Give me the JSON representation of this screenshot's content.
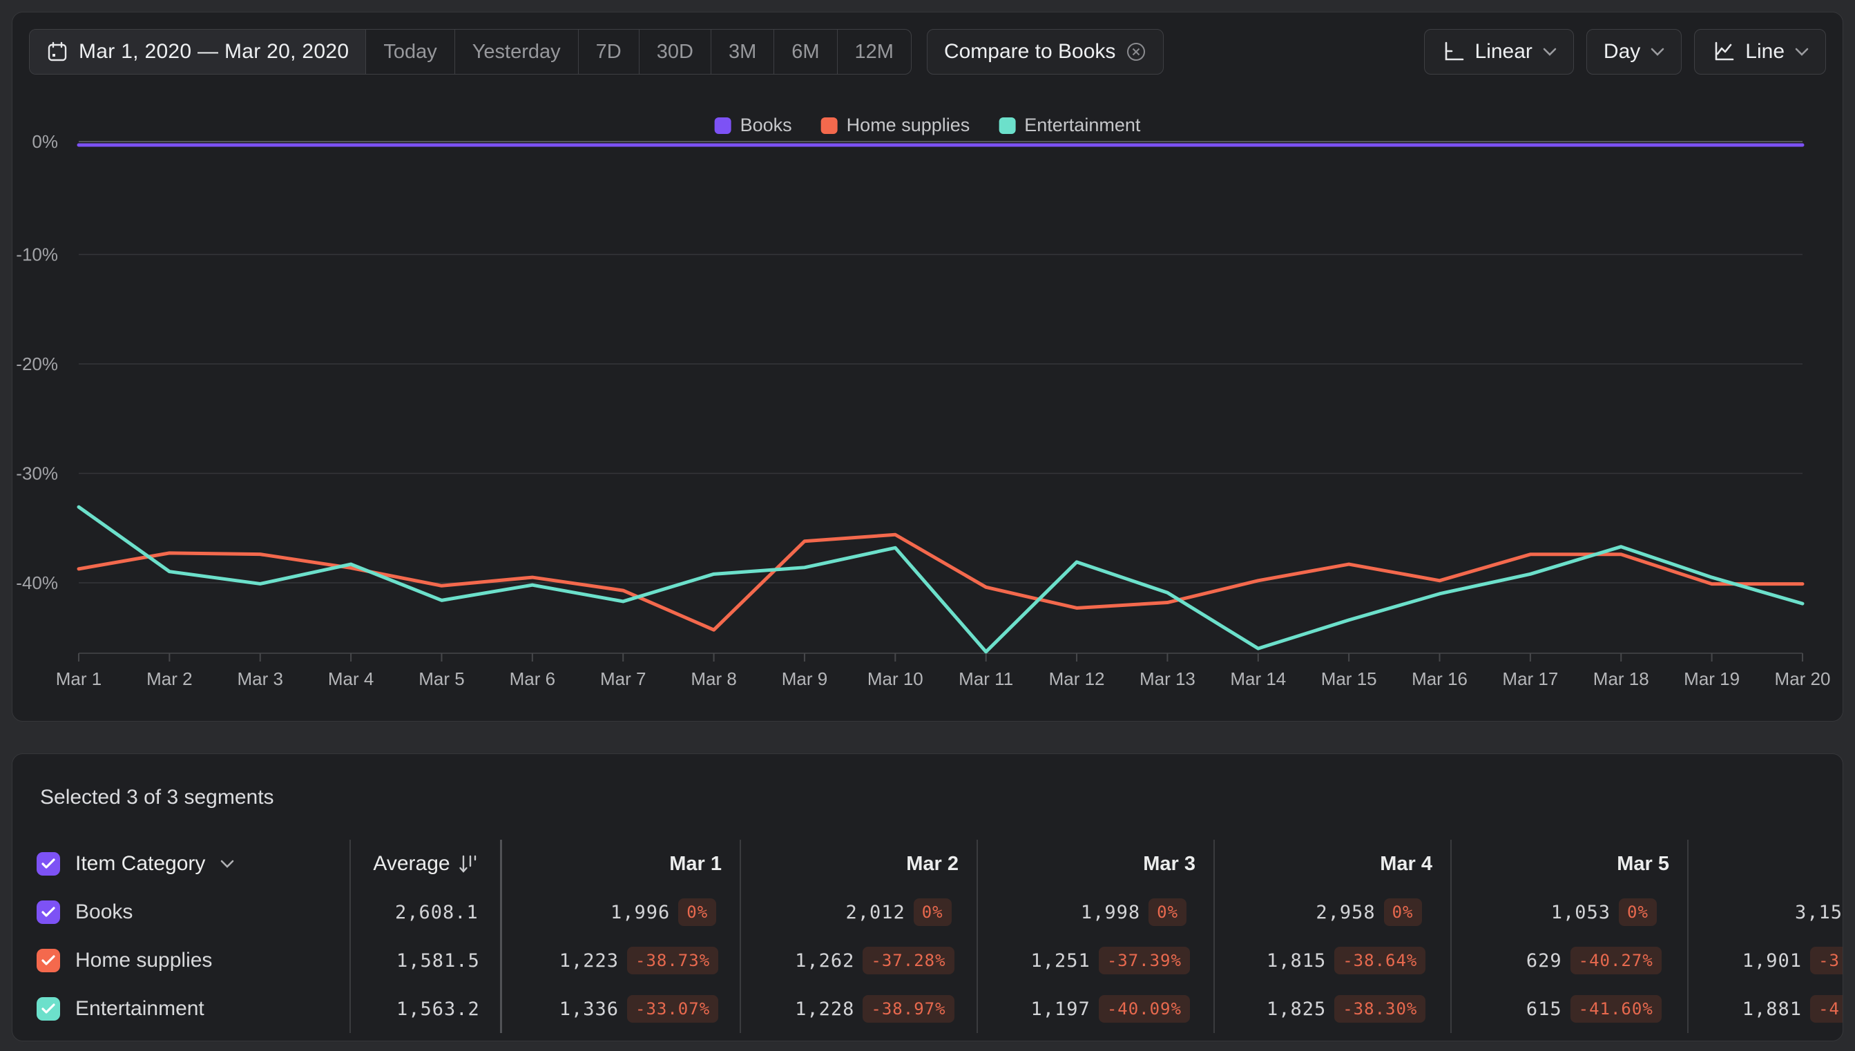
{
  "toolbar": {
    "date_range": "Mar 1, 2020 — Mar 20, 2020",
    "quick_ranges": [
      "Today",
      "Yesterday",
      "7D",
      "30D",
      "3M",
      "6M",
      "12M"
    ],
    "compare_label": "Compare to Books",
    "scale_label": "Linear",
    "granularity_label": "Day",
    "chart_type_label": "Line"
  },
  "legend": [
    {
      "label": "Books",
      "color": "#7d52f5"
    },
    {
      "label": "Home supplies",
      "color": "#f4694d"
    },
    {
      "label": "Entertainment",
      "color": "#6ce0cb"
    }
  ],
  "chart_data": {
    "type": "line",
    "title": "",
    "grid": "horizontal",
    "legend_position": "top-center",
    "ylim": [
      -46.5,
      0
    ],
    "y_ticks": [
      {
        "label": "0%",
        "value": 0
      },
      {
        "label": "-10%",
        "value": -10
      },
      {
        "label": "-20%",
        "value": -20
      },
      {
        "label": "-30%",
        "value": -30
      },
      {
        "label": "-40%",
        "value": -40
      }
    ],
    "x": [
      "Mar 1",
      "Mar 2",
      "Mar 3",
      "Mar 4",
      "Mar 5",
      "Mar 6",
      "Mar 7",
      "Mar 8",
      "Mar 9",
      "Mar 10",
      "Mar 11",
      "Mar 12",
      "Mar 13",
      "Mar 14",
      "Mar 15",
      "Mar 16",
      "Mar 17",
      "Mar 18",
      "Mar 19",
      "Mar 20"
    ],
    "series": [
      {
        "name": "Books",
        "color": "#7d52f5",
        "values": [
          0,
          0,
          0,
          0,
          0,
          0,
          0,
          0,
          0,
          0,
          0,
          0,
          0,
          0,
          0,
          0,
          0,
          0,
          0,
          0
        ]
      },
      {
        "name": "Home supplies",
        "color": "#f4694d",
        "values": [
          -38.73,
          -37.28,
          -37.39,
          -38.64,
          -40.27,
          -39.5,
          -40.7,
          -44.3,
          -36.2,
          -35.6,
          -40.4,
          -42.3,
          -41.8,
          -39.8,
          -38.3,
          -39.8,
          -37.4,
          -37.4,
          -40.1,
          -40.1
        ]
      },
      {
        "name": "Entertainment",
        "color": "#6ce0cb",
        "values": [
          -33.07,
          -38.97,
          -40.09,
          -38.3,
          -41.6,
          -40.2,
          -41.7,
          -39.2,
          -38.6,
          -36.8,
          -46.3,
          -38.1,
          -40.9,
          -46.0,
          -43.4,
          -41.0,
          -39.2,
          -36.7,
          -39.5,
          -41.9
        ]
      }
    ]
  },
  "table": {
    "title": "Selected 3 of 3 segments",
    "category_header": "Item Category",
    "average_header": "Average",
    "date_headers": [
      "Mar 1",
      "Mar 2",
      "Mar 3",
      "Mar 4",
      "Mar 5"
    ],
    "rows": [
      {
        "label": "Books",
        "color": "#7d52f5",
        "average": "2,608.1",
        "cells": [
          {
            "value": "1,996",
            "pct": "0%"
          },
          {
            "value": "2,012",
            "pct": "0%"
          },
          {
            "value": "1,998",
            "pct": "0%"
          },
          {
            "value": "2,958",
            "pct": "0%"
          },
          {
            "value": "1,053",
            "pct": "0%"
          }
        ],
        "partial": {
          "value": "3,15",
          "pct": ""
        }
      },
      {
        "label": "Home supplies",
        "color": "#f4694d",
        "average": "1,581.5",
        "cells": [
          {
            "value": "1,223",
            "pct": "-38.73%"
          },
          {
            "value": "1,262",
            "pct": "-37.28%"
          },
          {
            "value": "1,251",
            "pct": "-37.39%"
          },
          {
            "value": "1,815",
            "pct": "-38.64%"
          },
          {
            "value": "629",
            "pct": "-40.27%"
          }
        ],
        "partial": {
          "value": "1,901",
          "pct": "-3"
        }
      },
      {
        "label": "Entertainment",
        "color": "#6ce0cb",
        "average": "1,563.2",
        "cells": [
          {
            "value": "1,336",
            "pct": "-33.07%"
          },
          {
            "value": "1,228",
            "pct": "-38.97%"
          },
          {
            "value": "1,197",
            "pct": "-40.09%"
          },
          {
            "value": "1,825",
            "pct": "-38.30%"
          },
          {
            "value": "615",
            "pct": "-41.60%"
          }
        ],
        "partial": {
          "value": "1,881",
          "pct": "-4"
        }
      }
    ]
  }
}
